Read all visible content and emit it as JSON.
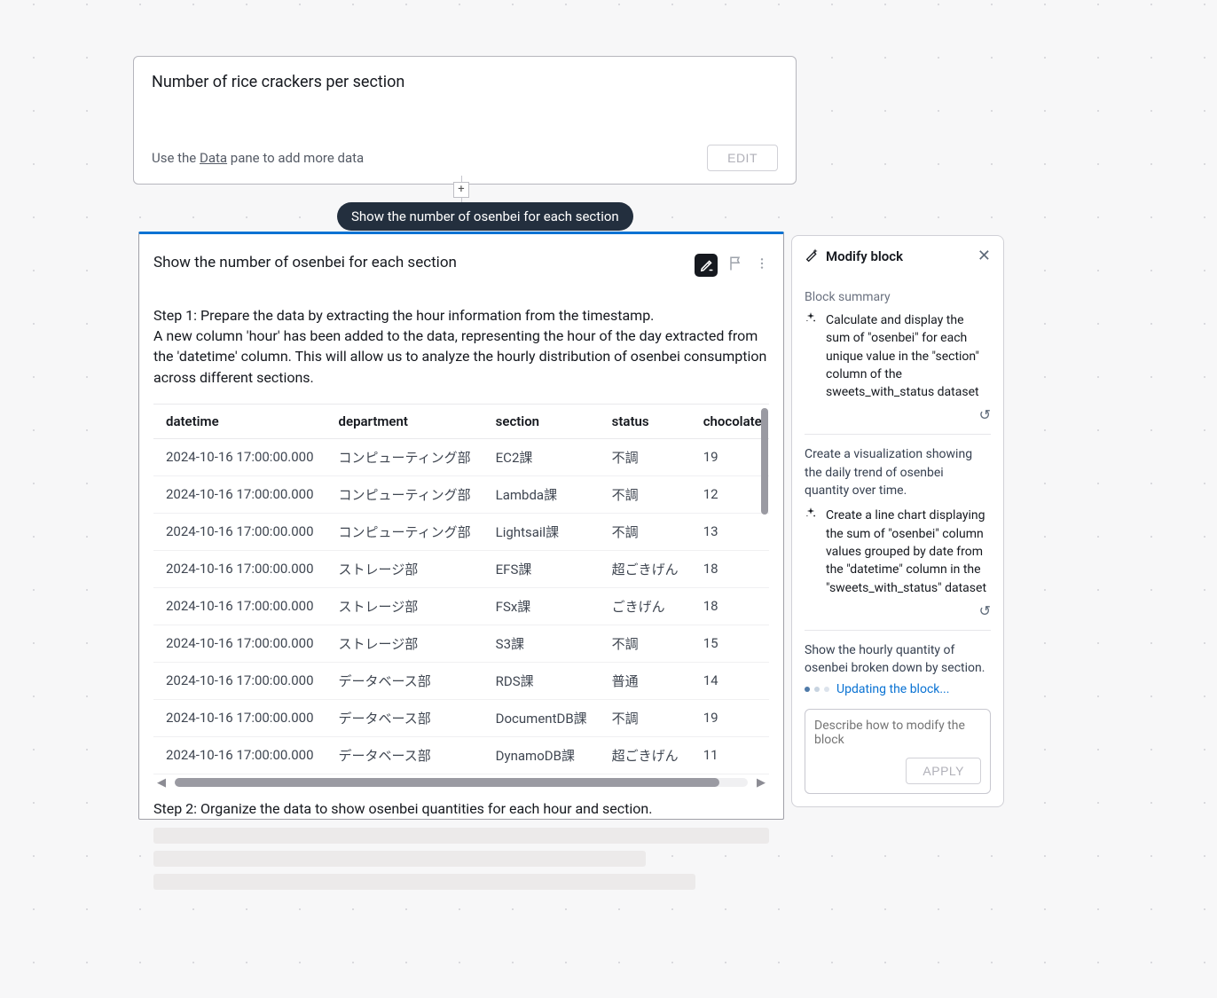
{
  "top_card": {
    "title": "Number of rice crackers per section",
    "hint_prefix": "Use the ",
    "hint_link": "Data",
    "hint_suffix": " pane to add more data",
    "edit_label": "EDIT"
  },
  "tooltip": "Show the number of osenbei for each section",
  "main": {
    "title": "Show the number of osenbei for each section",
    "step1_line1": "Step 1: Prepare the data by extracting the hour information from the timestamp.",
    "step1_body": "A new column 'hour' has been added to the data, representing the hour of the day extracted from the 'datetime' column. This will allow us to analyze the hourly distribution of osenbei consumption across different sections.",
    "columns": [
      "datetime",
      "department",
      "section",
      "status",
      "chocolate"
    ],
    "rows": [
      {
        "datetime": "2024-10-16 17:00:00.000",
        "department": "コンピューティング部",
        "section": "EC2課",
        "status": "不調",
        "chocolate": "19"
      },
      {
        "datetime": "2024-10-16 17:00:00.000",
        "department": "コンピューティング部",
        "section": "Lambda課",
        "status": "不調",
        "chocolate": "12"
      },
      {
        "datetime": "2024-10-16 17:00:00.000",
        "department": "コンピューティング部",
        "section": "Lightsail課",
        "status": "不調",
        "chocolate": "13"
      },
      {
        "datetime": "2024-10-16 17:00:00.000",
        "department": "ストレージ部",
        "section": "EFS課",
        "status": "超ごきげん",
        "chocolate": "18"
      },
      {
        "datetime": "2024-10-16 17:00:00.000",
        "department": "ストレージ部",
        "section": "FSx課",
        "status": "ごきげん",
        "chocolate": "18"
      },
      {
        "datetime": "2024-10-16 17:00:00.000",
        "department": "ストレージ部",
        "section": "S3課",
        "status": "不調",
        "chocolate": "15"
      },
      {
        "datetime": "2024-10-16 17:00:00.000",
        "department": "データベース部",
        "section": "RDS課",
        "status": "普通",
        "chocolate": "14"
      },
      {
        "datetime": "2024-10-16 17:00:00.000",
        "department": "データベース部",
        "section": "DocumentDB課",
        "status": "不調",
        "chocolate": "19"
      },
      {
        "datetime": "2024-10-16 17:00:00.000",
        "department": "データベース部",
        "section": "DynamoDB課",
        "status": "超ごきげん",
        "chocolate": "11"
      }
    ],
    "step2": "Step 2: Organize the data to show osenbei quantities for each hour and section."
  },
  "side": {
    "title": "Modify block",
    "summary_label": "Block summary",
    "summary_item": "Calculate and display the sum of \"osenbei\" for each unique value in the \"section\" column of the sweets_with_status dataset",
    "plain1": "Create a visualization showing the daily trend of osenbei quantity over time.",
    "item2": "Create a line chart displaying the sum of \"osenbei\" column values grouped by date from the \"datetime\" column in the \"sweets_with_status\" dataset",
    "plain2": "Show the hourly quantity of osenbei broken down by section.",
    "updating": "Updating the block...",
    "placeholder": "Describe how to modify the block",
    "apply_label": "APPLY"
  }
}
